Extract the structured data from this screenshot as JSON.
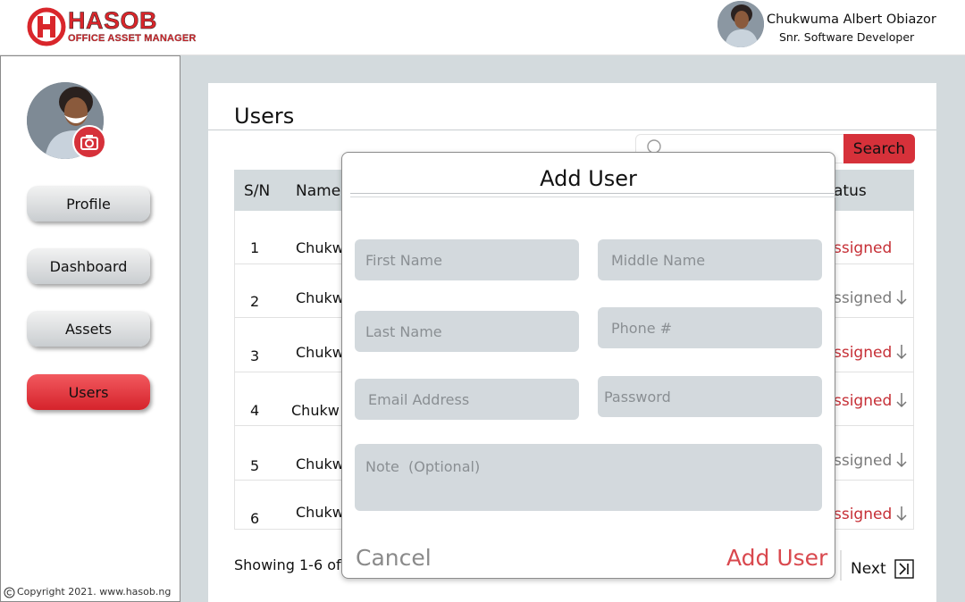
{
  "app": {
    "logo_text": "HASOB",
    "logo_subtitle": "OFFICE ASSET MANAGER",
    "brand_color": "#d9262b"
  },
  "header": {
    "user_name": "Chukwuma Albert Obiazor",
    "user_role": "Snr. Software Developer"
  },
  "sidebar": {
    "items": [
      {
        "label": "Profile",
        "active": false
      },
      {
        "label": "Dashboard",
        "active": false
      },
      {
        "label": "Assets",
        "active": false
      },
      {
        "label": "Users",
        "active": true
      }
    ],
    "camera_icon": "camera-icon",
    "copyright": "Copyright 2021. www.hasob.ng"
  },
  "main": {
    "title": "Users",
    "search": {
      "placeholder": "",
      "button_label": "Search"
    },
    "table": {
      "headers": [
        "S/N",
        "Name",
        "Status"
      ],
      "header_status_visible": "atus",
      "rows": [
        {
          "sn": "1",
          "name": "Chukw",
          "status": "ssigned",
          "status_color": "#c62f36",
          "arrow": false
        },
        {
          "sn": "2",
          "name": "Chukw",
          "status": "ssigned",
          "status_color": "#7a7a7a",
          "arrow": true
        },
        {
          "sn": "3",
          "name": "Chukw",
          "status": "ssigned",
          "status_color": "#c62f36",
          "arrow": true
        },
        {
          "sn": "4",
          "name": "Chukw",
          "status": "ssigned",
          "status_color": "#c62f36",
          "arrow": true
        },
        {
          "sn": "5",
          "name": "Chukw",
          "status": "ssigned",
          "status_color": "#7a7a7a",
          "arrow": true
        },
        {
          "sn": "6",
          "name": "Chukw",
          "status": "ssigned",
          "status_color": "#c62f36",
          "arrow": true
        }
      ]
    },
    "pagination": {
      "showing": "Showing 1-6 of",
      "next_label": "Next"
    }
  },
  "modal": {
    "title": "Add User",
    "fields": {
      "first_name": "First Name",
      "middle_name": "Middle Name",
      "last_name": "Last Name",
      "phone": "Phone #",
      "email": "Email Address",
      "password": "Password",
      "note": "Note  (Optional)"
    },
    "cancel_label": "Cancel",
    "submit_label": "Add User"
  }
}
